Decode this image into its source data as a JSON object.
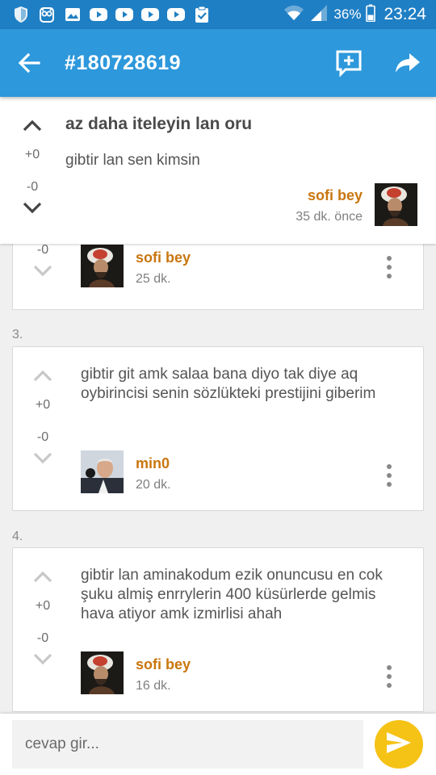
{
  "status_bar": {
    "battery": "36%",
    "time": "23:24",
    "left_icons": [
      "shield-icon",
      "owl-icon",
      "gallery-icon",
      "youtube-icon",
      "youtube-icon",
      "youtube-icon",
      "youtube-icon",
      "clipboard-check-icon"
    ],
    "right_icons": [
      "wifi-icon",
      "signal-icon",
      "battery-icon"
    ]
  },
  "app_bar": {
    "title": "#180728619",
    "color": "#2d98db",
    "actions": [
      "back-arrow-icon",
      "add-comment-icon",
      "share-icon"
    ]
  },
  "topic": {
    "title": "az daha iteleyin lan oru",
    "body": "gibtir lan sen kimsin",
    "upvotes": "+0",
    "downvotes": "-0",
    "author": "sofi bey",
    "time": "35 dk. önce"
  },
  "entries": [
    {
      "number": "",
      "downvotes": "-0",
      "author": "sofi bey",
      "time": "25 dk."
    },
    {
      "number": "3.",
      "body": "gibtir git amk salaa bana diyo tak diye aq oybirincisi senin sözlükteki prestijini giberim",
      "upvotes": "+0",
      "downvotes": "-0",
      "author": "min0",
      "time": "20 dk."
    },
    {
      "number": "4.",
      "body": "gibtir lan aminakodum ezik onuncusu en cok şuku almiş enrrylerin 400 küsürlerde gelmis hava atiyor amk izmirlisi ahah",
      "upvotes": "+0",
      "downvotes": "-0",
      "author": "sofi bey",
      "time": "16 dk."
    }
  ],
  "reply": {
    "placeholder": "cevap gir...",
    "send_color": "#f5c216"
  }
}
